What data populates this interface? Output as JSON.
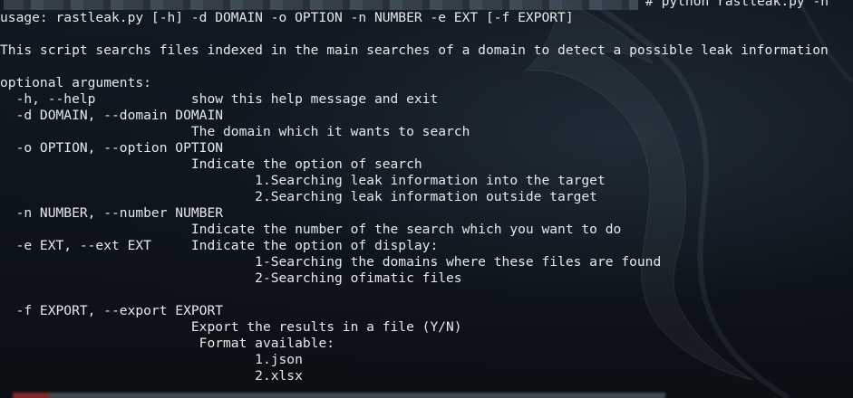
{
  "terminal": {
    "prompt_command": "# python rastleak.py -h",
    "usage": "usage: rastleak.py [-h] -d DOMAIN -o OPTION -n NUMBER -e EXT [-f EXPORT]",
    "description": "This script searchs files indexed in the main searches of a domain to detect a possible leak information",
    "section_header": "optional arguments:",
    "help_arg": "  -h, --help            show this help message and exit",
    "domain_arg": "  -d DOMAIN, --domain DOMAIN",
    "domain_desc": "                        The domain which it wants to search",
    "option_arg": "  -o OPTION, --option OPTION",
    "option_desc": "                        Indicate the option of search",
    "option_1": "                                1.Searching leak information into the target",
    "option_2": "                                2.Searching leak information outside target",
    "number_arg": "  -n NUMBER, --number NUMBER",
    "number_desc": "                        Indicate the number of the search which you want to do",
    "ext_arg": "  -e EXT, --ext EXT     Indicate the option of display:",
    "ext_1": "                                1-Searching the domains where these files are found",
    "ext_2": "                                2-Searching ofimatic files",
    "export_arg": "  -f EXPORT, --export EXPORT",
    "export_desc": "                        Export the results in a file (Y/N)",
    "format_header": "                         Format available:",
    "format_1": "                                1.json",
    "format_2": "                                2.xlsx"
  }
}
